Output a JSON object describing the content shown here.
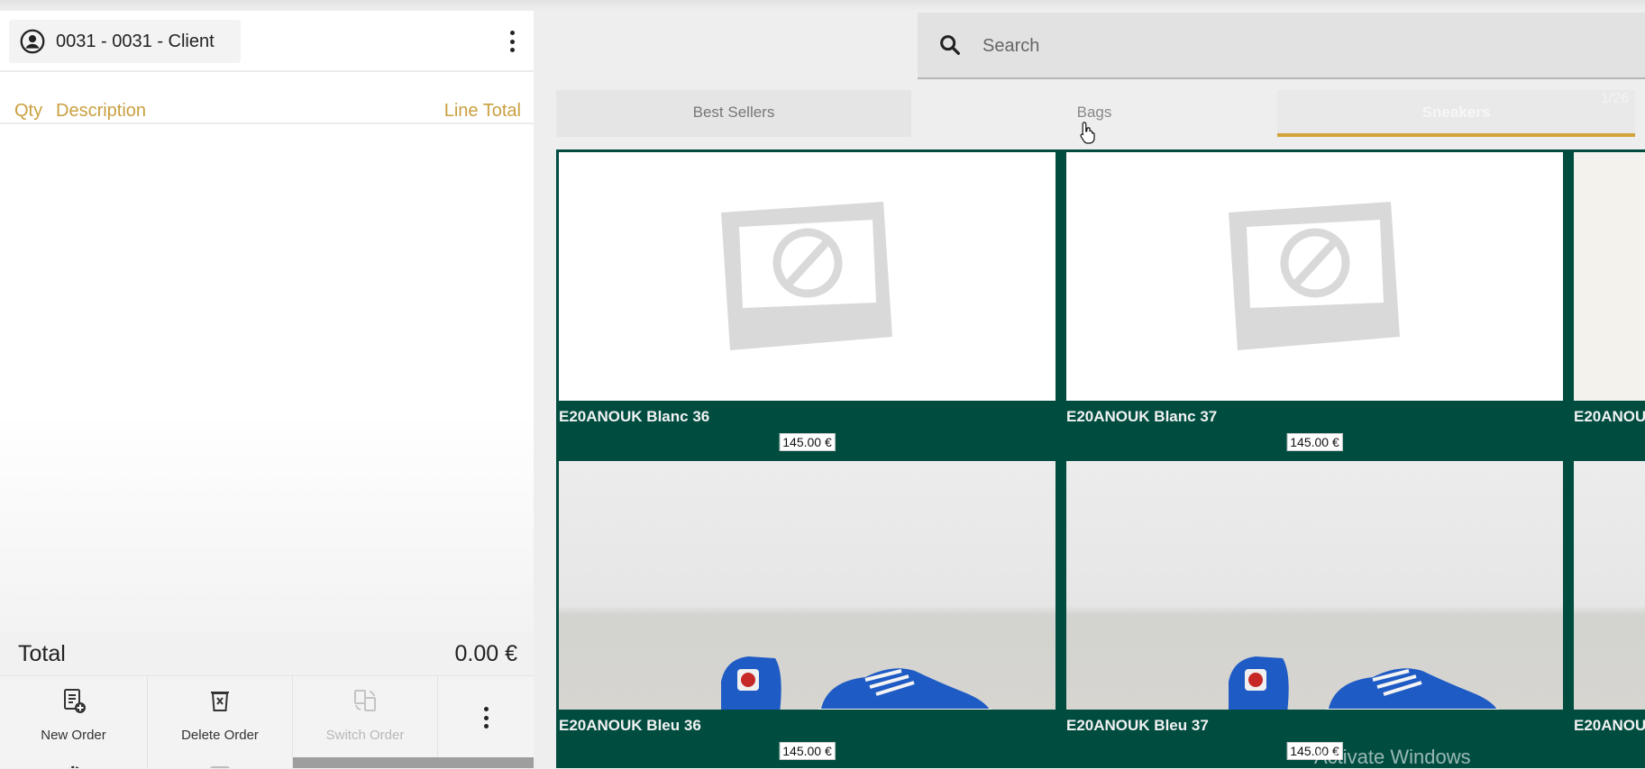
{
  "client": {
    "label": "0031 - 0031 - Client"
  },
  "order_table": {
    "columns": {
      "qty": "Qty",
      "description": "Description",
      "line_total": "Line Total"
    }
  },
  "totals": {
    "label": "Total",
    "value": "0.00 €"
  },
  "actions": {
    "new_order": "New Order",
    "delete_order": "Delete Order",
    "switch_order": "Switch Order"
  },
  "search": {
    "placeholder": "Search"
  },
  "tabs": [
    {
      "label": "Best Sellers"
    },
    {
      "label": "Bags"
    },
    {
      "label": "Sneakers",
      "active": true
    }
  ],
  "pager": {
    "text": "1/26"
  },
  "products": [
    {
      "name": "E20ANOUK Blanc 36",
      "price": "145.00 €"
    },
    {
      "name": "E20ANOUK Blanc 37",
      "price": "145.00 €"
    },
    {
      "name": "E20ANOU"
    },
    {
      "name": "E20ANOUK Bleu 36",
      "price": "145.00 €"
    },
    {
      "name": "E20ANOUK Bleu 37",
      "price": "145.00 €"
    },
    {
      "name": "E20ANOU"
    }
  ],
  "watermark": {
    "text": "Activate Windows"
  },
  "colors": {
    "accent": "#d4a33a",
    "product_bg": "#004d40",
    "column_header": "#c9a03f"
  }
}
